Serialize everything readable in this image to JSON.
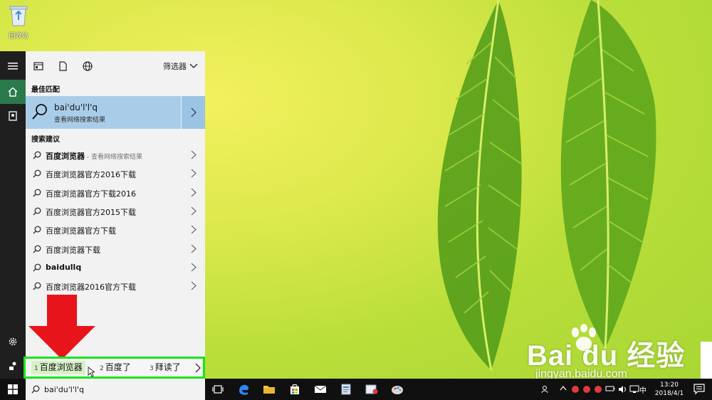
{
  "desktop": {
    "recycle_bin_label": "回收站",
    "watermark_brand": "Bai du 经验",
    "watermark_url": "jingyan.baidu.com"
  },
  "filters": {
    "filter_label": "筛选器"
  },
  "best_match": {
    "section_label": "最佳匹配",
    "title": "bai'du'l'l'q",
    "subtitle": "查看网络搜索结果"
  },
  "suggestions": {
    "section_label": "搜索建议",
    "items": [
      {
        "text": "百度浏览器",
        "hint": " - 查看网络搜索结果",
        "bold": true
      },
      {
        "text": "百度浏览器官方2016下载",
        "hint": "",
        "bold": false
      },
      {
        "text": "百度浏览器官方下载2016",
        "hint": "",
        "bold": false
      },
      {
        "text": "百度浏览器官方2015下载",
        "hint": "",
        "bold": false
      },
      {
        "text": "百度浏览器官方下载",
        "hint": "",
        "bold": false
      },
      {
        "text": "百度浏览器下载",
        "hint": "",
        "bold": false
      },
      {
        "text": "baidullq",
        "hint": "",
        "bold": true
      },
      {
        "text": "百度浏览器2016官方下载",
        "hint": "",
        "bold": false
      }
    ]
  },
  "ime": {
    "candidates": [
      {
        "num": "1",
        "text": "百度浏览器"
      },
      {
        "num": "2",
        "text": "百度了"
      },
      {
        "num": "3",
        "text": "拜读了"
      }
    ]
  },
  "taskbar": {
    "search_value": "bai'du'l'l'q",
    "ime_lang": "中",
    "time": "13:20",
    "date": "2018/4/1"
  },
  "colors": {
    "ime_highlight_border": "#19e619",
    "annotation_arrow": "#e8141c",
    "best_match_bg": "#a9cde9",
    "rail_active": "#2a7a4c"
  }
}
